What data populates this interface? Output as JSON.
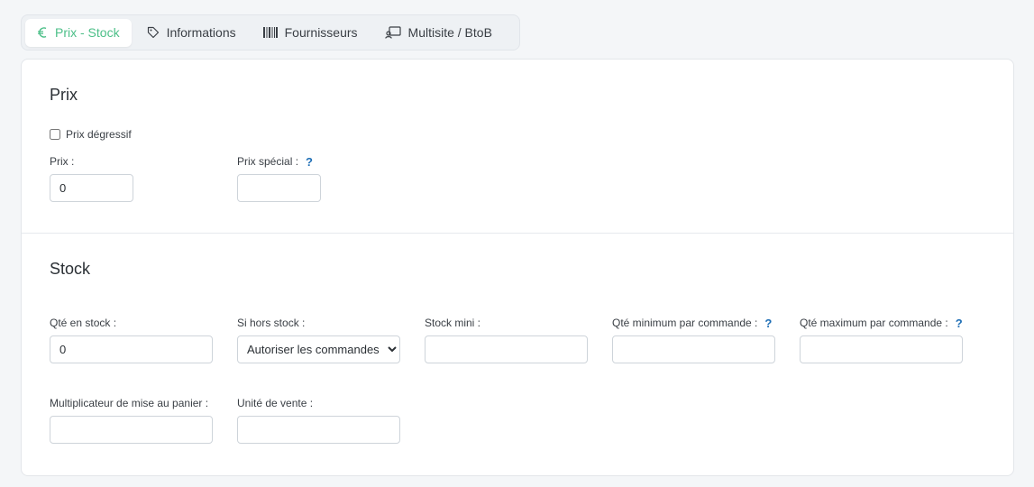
{
  "tabs": [
    {
      "label": "Prix - Stock",
      "icon": "euro-icon",
      "active": true
    },
    {
      "label": "Informations",
      "icon": "tag-icon",
      "active": false
    },
    {
      "label": "Fournisseurs",
      "icon": "barcode-icon",
      "active": false
    },
    {
      "label": "Multisite / BtoB",
      "icon": "multisite-icon",
      "active": false
    }
  ],
  "prix": {
    "title": "Prix",
    "degressif_label": "Prix dégressif",
    "prix_label": "Prix :",
    "prix_value": "0",
    "special_label": "Prix spécial :",
    "special_value": "",
    "help": "?"
  },
  "stock": {
    "title": "Stock",
    "qte_label": "Qté en stock :",
    "qte_value": "0",
    "hors_stock_label": "Si hors stock :",
    "hors_stock_value": "Autoriser les commandes",
    "mini_label": "Stock mini :",
    "mini_value": "",
    "qte_min_label": "Qté minimum par commande :",
    "qte_min_value": "",
    "qte_max_label": "Qté maximum par commande :",
    "qte_max_value": "",
    "multiplicateur_label": "Multiplicateur de mise au panier :",
    "multiplicateur_value": "",
    "unite_label": "Unité de vente :",
    "unite_value": "",
    "help": "?"
  },
  "colors": {
    "accent": "#4cbf88",
    "help": "#1f6fb6"
  }
}
